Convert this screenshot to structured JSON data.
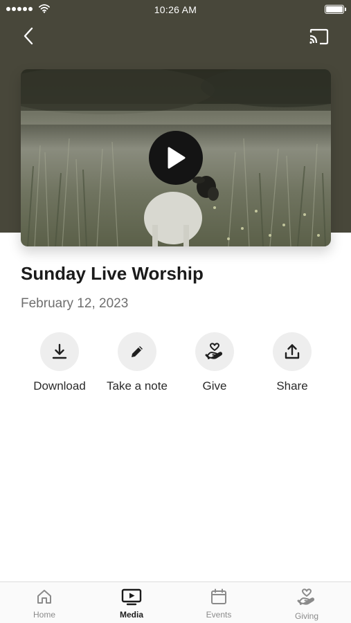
{
  "status_bar": {
    "time": "10:26 AM"
  },
  "header": {
    "back_icon": "chevron-left-icon",
    "cast_icon": "cast-icon",
    "background_color": "#48473a"
  },
  "media": {
    "thumbnail": "lamb-in-grass-field",
    "play_icon": "play-icon",
    "title": "Sunday Live Worship",
    "date": "February 12, 2023"
  },
  "actions": [
    {
      "label": "Download",
      "icon": "download-icon"
    },
    {
      "label": "Take a note",
      "icon": "pencil-icon"
    },
    {
      "label": "Give",
      "icon": "heart-hand-icon"
    },
    {
      "label": "Share",
      "icon": "share-icon"
    }
  ],
  "tab_bar": {
    "items": [
      {
        "label": "Home",
        "icon": "home-icon",
        "active": false
      },
      {
        "label": "Media",
        "icon": "tv-play-icon",
        "active": true
      },
      {
        "label": "Events",
        "icon": "calendar-icon",
        "active": false
      },
      {
        "label": "Giving",
        "icon": "heart-hand-icon",
        "active": false
      }
    ]
  }
}
